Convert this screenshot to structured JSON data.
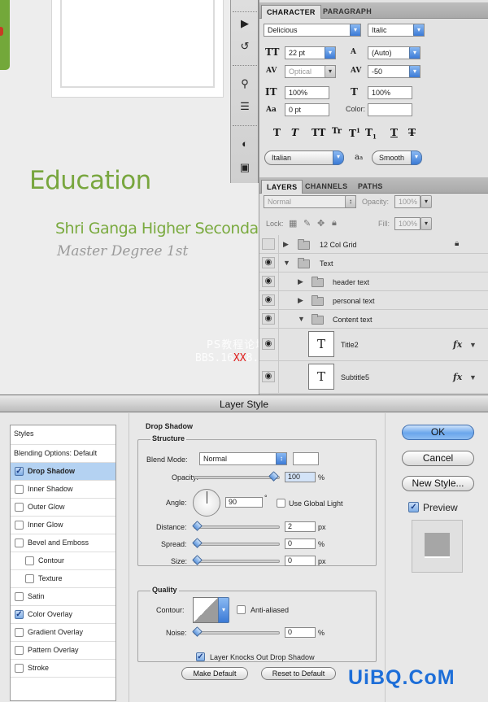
{
  "document": {
    "section_title": "Education",
    "school_name": "Shri Ganga Higher Secondary",
    "degree": "Master Degree 1st",
    "watermark_line1": "PS教程论坛",
    "watermark_line2_a": "BBS.16",
    "watermark_line2_b": "XX",
    "watermark_line2_c": "8.COM"
  },
  "character_panel": {
    "tab_character": "CHARACTER",
    "tab_paragraph": "PARAGRAPH",
    "font_family": "Delicious",
    "font_style": "Italic",
    "font_size": "22 pt",
    "leading": "(Auto)",
    "kerning": "Optical",
    "tracking": "-50",
    "vertical_scale": "100%",
    "horizontal_scale": "100%",
    "baseline_shift": "0 pt",
    "color_label": "Color:",
    "language": "Italian",
    "antialias_glyph": "a",
    "antialias_glyph_small": "a",
    "antialias": "Smooth",
    "glyph_buttons": [
      "T",
      "T",
      "TT",
      "Tr",
      "T",
      "T",
      "T",
      "T"
    ],
    "glyph_sup": "1",
    "glyph_sub": "1"
  },
  "layers_panel": {
    "tab_layers": "LAYERS",
    "tab_channels": "CHANNELS",
    "tab_paths": "PATHS",
    "blend_mode": "Normal",
    "opacity_label": "Opacity:",
    "opacity": "100%",
    "lock_label": "Lock:",
    "fill_label": "Fill:",
    "fill": "100%",
    "layers": [
      {
        "name": "12 Col Grid",
        "type": "folder",
        "visible": false,
        "expanded": false
      },
      {
        "name": "Text",
        "type": "folder",
        "visible": true,
        "expanded": true
      },
      {
        "name": "header text",
        "type": "folder",
        "visible": true,
        "expanded": false
      },
      {
        "name": "personal text",
        "type": "folder",
        "visible": true,
        "expanded": false
      },
      {
        "name": "Content text",
        "type": "folder",
        "visible": true,
        "expanded": true
      },
      {
        "name": "Title2",
        "type": "text",
        "visible": true,
        "thumb": "T",
        "fx": "fx"
      },
      {
        "name": "Subtitle5",
        "type": "text",
        "visible": true,
        "thumb": "T",
        "fx": "fx"
      }
    ]
  },
  "dialog": {
    "title": "Layer Style",
    "styles_header": "Styles",
    "styles": [
      {
        "label": "Blending Options: Default",
        "checkbox": false,
        "checked": false,
        "selected": false,
        "indent": false
      },
      {
        "label": "Drop Shadow",
        "checkbox": true,
        "checked": true,
        "selected": true,
        "indent": false
      },
      {
        "label": "Inner Shadow",
        "checkbox": true,
        "checked": false,
        "selected": false,
        "indent": false
      },
      {
        "label": "Outer Glow",
        "checkbox": true,
        "checked": false,
        "selected": false,
        "indent": false
      },
      {
        "label": "Inner Glow",
        "checkbox": true,
        "checked": false,
        "selected": false,
        "indent": false
      },
      {
        "label": "Bevel and Emboss",
        "checkbox": true,
        "checked": false,
        "selected": false,
        "indent": false
      },
      {
        "label": "Contour",
        "checkbox": true,
        "checked": false,
        "selected": false,
        "indent": true
      },
      {
        "label": "Texture",
        "checkbox": true,
        "checked": false,
        "selected": false,
        "indent": true
      },
      {
        "label": "Satin",
        "checkbox": true,
        "checked": false,
        "selected": false,
        "indent": false
      },
      {
        "label": "Color Overlay",
        "checkbox": true,
        "checked": true,
        "selected": false,
        "indent": false
      },
      {
        "label": "Gradient Overlay",
        "checkbox": true,
        "checked": false,
        "selected": false,
        "indent": false
      },
      {
        "label": "Pattern Overlay",
        "checkbox": true,
        "checked": false,
        "selected": false,
        "indent": false
      },
      {
        "label": "Stroke",
        "checkbox": true,
        "checked": false,
        "selected": false,
        "indent": false
      }
    ],
    "drop_shadow": {
      "section": "Drop Shadow",
      "structure": "Structure",
      "blend_mode_label": "Blend Mode:",
      "blend_mode": "Normal",
      "opacity_label": "Opacity:",
      "opacity": "100",
      "opacity_unit": "%",
      "angle_label": "Angle:",
      "angle": "90",
      "angle_unit": "°",
      "use_global_light": "Use Global Light",
      "distance_label": "Distance:",
      "distance": "2",
      "spread_label": "Spread:",
      "spread": "0",
      "size_label": "Size:",
      "size": "0",
      "px": "px",
      "percent": "%",
      "quality": "Quality",
      "contour_label": "Contour:",
      "anti_aliased": "Anti-aliased",
      "noise_label": "Noise:",
      "noise": "0",
      "knockout": "Layer Knocks Out Drop Shadow",
      "make_default": "Make Default",
      "reset_default": "Reset to Default"
    },
    "buttons": {
      "ok": "OK",
      "cancel": "Cancel",
      "new_style": "New Style...",
      "preview": "Preview"
    },
    "slider_levels": {
      "opacity": 1.0,
      "distance": 0.0,
      "spread": 0.0,
      "size": 0.0,
      "noise": 0.0
    }
  },
  "branding": {
    "logo": "UiBQ.CoM",
    "logo_color": "#1d6ed8"
  },
  "colors": {
    "green_text": "#78a63e",
    "grey_text": "#9a9a9a",
    "selection": "#b4d2f2"
  }
}
